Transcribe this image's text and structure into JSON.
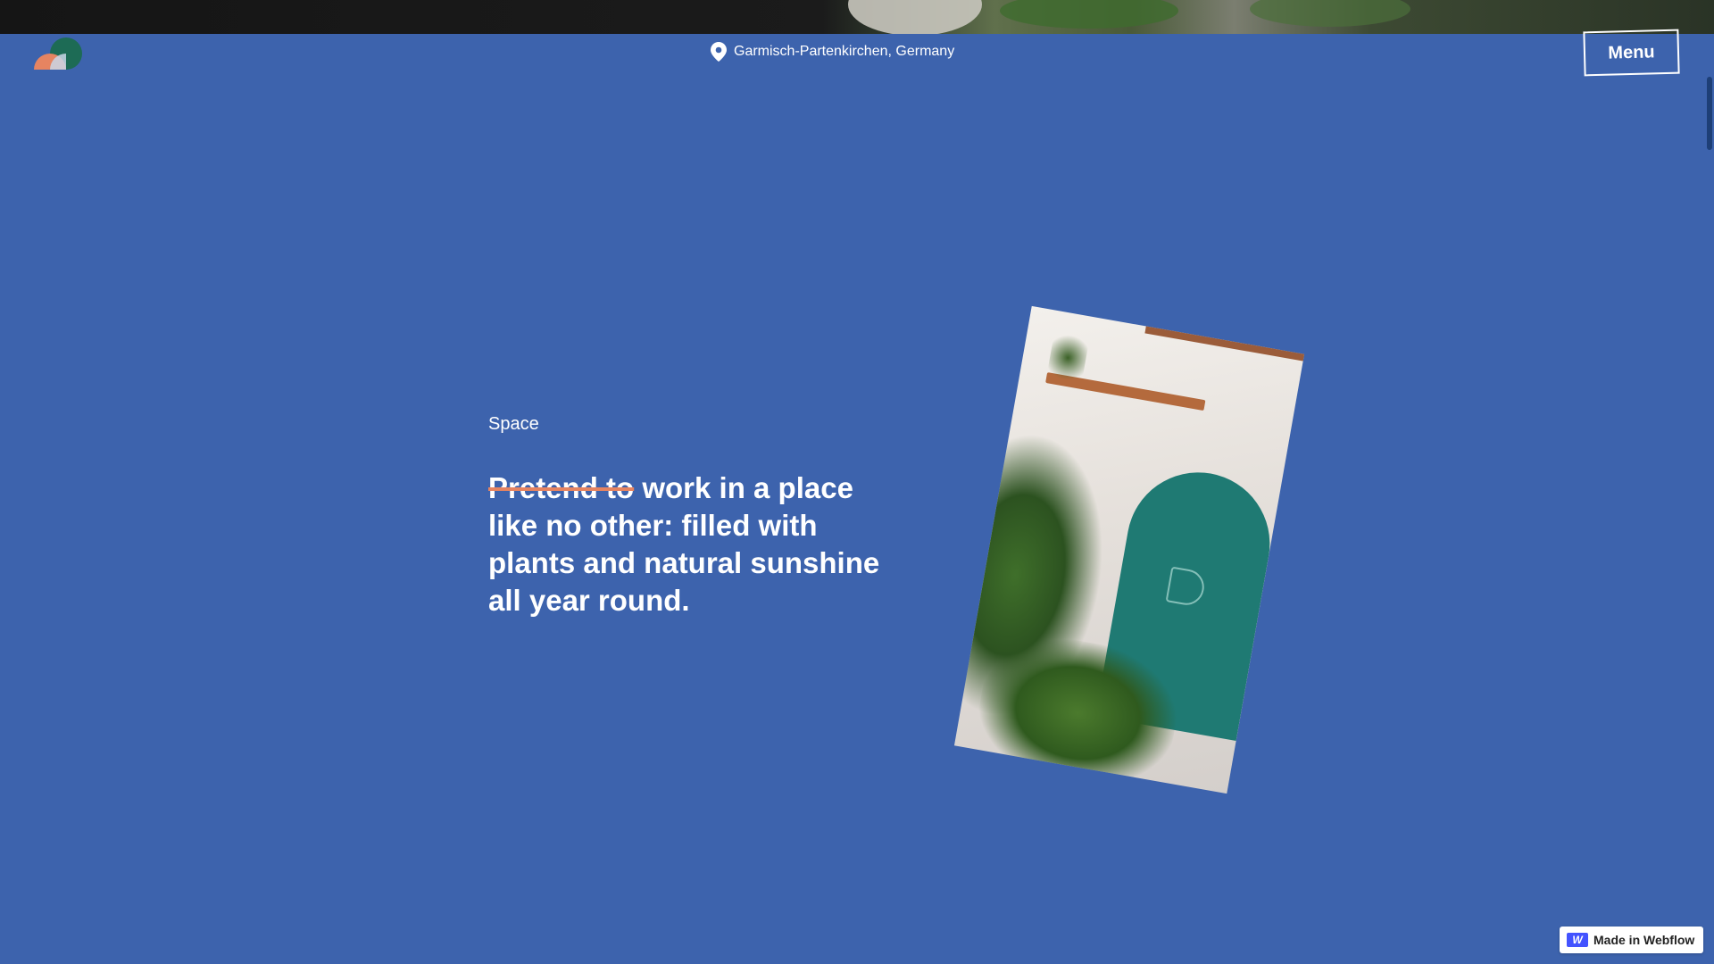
{
  "header": {
    "location": "Garmisch-Partenkirchen, Germany",
    "menu_label": "Menu"
  },
  "hero": {
    "eyebrow": "Space",
    "headline_struck": "Pretend to",
    "headline_rest": " work in a place like no other: filled with plants and natural sunshine all year round."
  },
  "badge": {
    "label": "Made in Webflow",
    "icon": "webflow-logo-icon"
  },
  "colors": {
    "background": "#3d63ad",
    "strike": "#e68461",
    "logo_green": "#1d6b55",
    "logo_orange": "#e68461"
  }
}
